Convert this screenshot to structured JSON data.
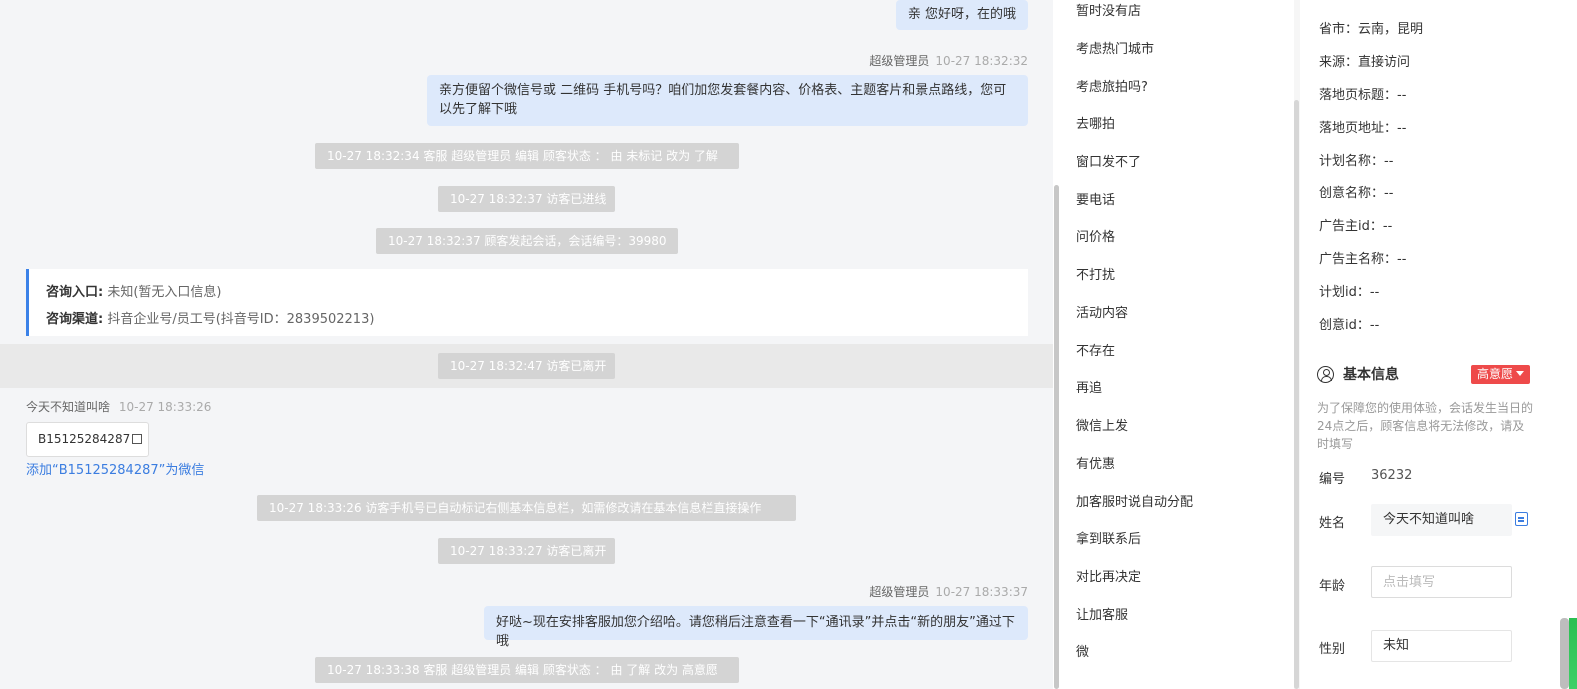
{
  "chat": {
    "messages": [
      {
        "text": "亲 您好呀，在的哦"
      },
      {
        "sender": "超级管理员",
        "time": "10-27 18:32:32",
        "text": "亲方便留个微信号或 二维码 手机号吗？咱们加您发套餐内容、价格表、主题客片和景点路线，您可以先了解下哦"
      },
      {
        "sender": "超级管理员",
        "time": "10-27 18:33:37",
        "text": "好哒~现在安排客服加您介绍哈。请您稍后注意查看一下“通讯录”并点击“新的朋友”通过下哦"
      }
    ],
    "system": [
      "10-27 18:32:34 客服 超级管理员 编辑 顾客状态 ： 由 未标记 改为 了解",
      "10-27 18:32:37 访客已进线",
      "10-27 18:32:37 顾客发起会话，会话编号：39980",
      "10-27 18:32:47 访客已离开",
      "10-27 18:33:26 访客手机号已自动标记右侧基本信息栏，如需修改请在基本信息栏直接操作",
      "10-27 18:33:27 访客已离开",
      "10-27 18:33:38 客服 超级管理员 编辑 顾客状态 ： 由 了解 改为 高意愿"
    ],
    "source": {
      "entry_label": "咨询入口:",
      "entry_value": "未知(暂无入口信息)",
      "channel_label": "咨询渠道:",
      "channel_value": "抖音企业号/员工号(抖音号ID：2839502213)"
    },
    "visitor": {
      "name": "今天不知道叫啥",
      "time": "10-27 18:33:26",
      "copy_text": "B15125284287",
      "add_wechat": "添加“B15125284287”为微信"
    }
  },
  "quick_replies": [
    "暂时没有店",
    "考虑热门城市",
    "考虑旅拍吗?",
    "去哪拍",
    "窗口发不了",
    "要电话",
    "问价格",
    "不打扰",
    "活动内容",
    "不存在",
    "再追",
    "微信上发",
    "有优惠",
    "加客服时说自动分配",
    "拿到联系后",
    "对比再决定",
    "让加客服",
    "微"
  ],
  "info": {
    "source_fields": [
      {
        "label": "省市：",
        "value": "云南，昆明"
      },
      {
        "label": "来源：",
        "value": "直接访问"
      },
      {
        "label": "落地页标题：",
        "value": "--"
      },
      {
        "label": "落地页地址：",
        "value": "--"
      },
      {
        "label": "计划名称：",
        "value": "--"
      },
      {
        "label": "创意名称：",
        "value": "--"
      },
      {
        "label": "广告主id：",
        "value": "--"
      },
      {
        "label": "广告主名称：",
        "value": "--"
      },
      {
        "label": "计划id：",
        "value": "--"
      },
      {
        "label": "创意id：",
        "value": "--"
      }
    ],
    "basic": {
      "title": "基本信息",
      "intent": "高意愿",
      "notice": "为了保障您的使用体验，会话发生当日的24点之后，顾客信息将无法修改，请及时填写",
      "id_label": "编号",
      "id_value": "36232",
      "name_label": "姓名",
      "name_value": "今天不知道叫啥",
      "age_label": "年龄",
      "age_placeholder": "点击填写",
      "gender_label": "性别",
      "gender_value": "未知"
    }
  },
  "colors": {
    "accent": "#3b7de0",
    "bubble": "#dde9fb",
    "intent_badge": "#ee4a4a",
    "system_pill": "#d4d4d4"
  }
}
